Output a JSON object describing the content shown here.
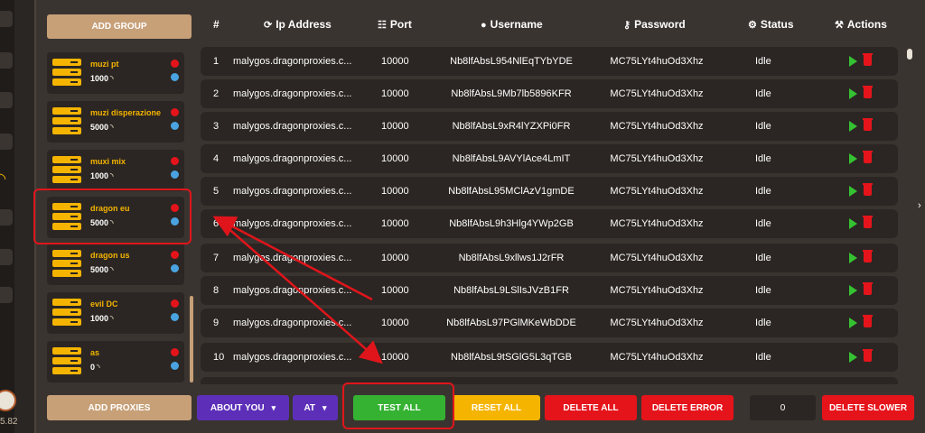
{
  "version": "5.82",
  "sidebar": {
    "add_group_label": "ADD GROUP",
    "add_proxies_label": "ADD PROXIES",
    "groups": [
      {
        "name": "muzi pt",
        "count": "1000"
      },
      {
        "name": "muzi disperazione",
        "count": "5000"
      },
      {
        "name": "muxi mix",
        "count": "1000"
      },
      {
        "name": "dragon eu",
        "count": "5000"
      },
      {
        "name": "dragon us",
        "count": "5000"
      },
      {
        "name": "evil DC",
        "count": "1000"
      },
      {
        "name": "as",
        "count": "0"
      }
    ]
  },
  "table": {
    "headers": {
      "num": "#",
      "ip": "Ip Address",
      "port": "Port",
      "username": "Username",
      "password": "Password",
      "status": "Status",
      "actions": "Actions"
    },
    "rows": [
      {
        "num": "1",
        "ip": "malygos.dragonproxies.c...",
        "port": "10000",
        "user": "Nb8lfAbsL954NlEqTYbYDE",
        "pass": "MC75LYt4huOd3Xhz",
        "status": "Idle"
      },
      {
        "num": "2",
        "ip": "malygos.dragonproxies.c...",
        "port": "10000",
        "user": "Nb8lfAbsL9Mb7lb5896KFR",
        "pass": "MC75LYt4huOd3Xhz",
        "status": "Idle"
      },
      {
        "num": "3",
        "ip": "malygos.dragonproxies.c...",
        "port": "10000",
        "user": "Nb8lfAbsL9xR4lYZXPi0FR",
        "pass": "MC75LYt4huOd3Xhz",
        "status": "Idle"
      },
      {
        "num": "4",
        "ip": "malygos.dragonproxies.c...",
        "port": "10000",
        "user": "Nb8lfAbsL9AVYlAce4LmIT",
        "pass": "MC75LYt4huOd3Xhz",
        "status": "Idle"
      },
      {
        "num": "5",
        "ip": "malygos.dragonproxies.c...",
        "port": "10000",
        "user": "Nb8lfAbsL95MClAzV1gmDE",
        "pass": "MC75LYt4huOd3Xhz",
        "status": "Idle"
      },
      {
        "num": "6",
        "ip": "malygos.dragonproxies.c...",
        "port": "10000",
        "user": "Nb8lfAbsL9h3Hlg4YWp2GB",
        "pass": "MC75LYt4huOd3Xhz",
        "status": "Idle"
      },
      {
        "num": "7",
        "ip": "malygos.dragonproxies.c...",
        "port": "10000",
        "user": "Nb8lfAbsL9xllws1J2rFR",
        "pass": "MC75LYt4huOd3Xhz",
        "status": "Idle"
      },
      {
        "num": "8",
        "ip": "malygos.dragonproxies.c...",
        "port": "10000",
        "user": "Nb8lfAbsL9LSlIsJVzB1FR",
        "pass": "MC75LYt4huOd3Xhz",
        "status": "Idle"
      },
      {
        "num": "9",
        "ip": "malygos.dragonproxies.c...",
        "port": "10000",
        "user": "Nb8lfAbsL97PGlMKeWbDDE",
        "pass": "MC75LYt4huOd3Xhz",
        "status": "Idle"
      },
      {
        "num": "10",
        "ip": "malygos.dragonproxies.c...",
        "port": "10000",
        "user": "Nb8lfAbsL9tSGlG5L3qTGB",
        "pass": "MC75LYt4huOd3Xhz",
        "status": "Idle"
      }
    ]
  },
  "toolbar": {
    "about_you": "ABOUT YOU",
    "country": "AT",
    "test_all": "TEST ALL",
    "reset_all": "RESET ALL",
    "delete_all": "DELETE ALL",
    "delete_error": "DELETE ERROR",
    "counter_value": "0",
    "delete_slower": "DELETE SLOWER"
  },
  "colors": {
    "accent_gold": "#f5b400",
    "tan_button": "#c7a078",
    "success_green": "#35b232",
    "danger_red": "#e5141b",
    "select_purple": "#5d2fb8",
    "annotation_red": "#e0151b"
  }
}
